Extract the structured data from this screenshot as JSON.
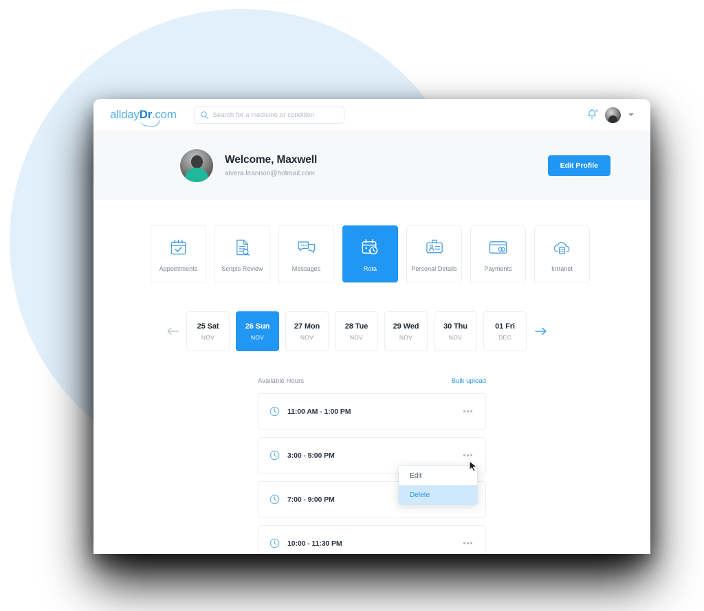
{
  "brand": {
    "logo_light_1": "allday",
    "logo_bold": "Dr",
    "logo_light_2": ".com",
    "accent_color": "#2196f3",
    "bg_circle_color": "#e1f0fb"
  },
  "topbar": {
    "search": {
      "placeholder": "Search for a medicine or condition",
      "value": "",
      "icon": "search-icon"
    },
    "notification_icon": "bell-icon",
    "avatar_icon": "user-avatar",
    "dropdown_icon": "chevron-down-icon"
  },
  "welcome": {
    "title": "Welcome, Maxwell",
    "email": "alvera.leannon@hotmail.com",
    "edit_button": "Edit Profile"
  },
  "nav_cards": [
    {
      "label": "Appointments",
      "icon": "calendar-check-icon",
      "active": false
    },
    {
      "label": "Scripts Review",
      "icon": "document-search-icon",
      "active": false
    },
    {
      "label": "Messages",
      "icon": "chat-bubbles-icon",
      "active": false
    },
    {
      "label": "Rota",
      "icon": "calendar-clock-icon",
      "active": true
    },
    {
      "label": "Personal Details",
      "icon": "id-badge-icon",
      "active": false
    },
    {
      "label": "Payments",
      "icon": "credit-card-icon",
      "active": false
    },
    {
      "label": "Intranet",
      "icon": "cloud-file-icon",
      "active": false
    }
  ],
  "date_strip": {
    "prev_icon": "arrow-left-icon",
    "next_icon": "arrow-right-icon",
    "days": [
      {
        "day": "25 Sat",
        "month": "NOV",
        "active": false
      },
      {
        "day": "26 Sun",
        "month": "NOV",
        "active": true
      },
      {
        "day": "27 Mon",
        "month": "NOV",
        "active": false
      },
      {
        "day": "28 Tue",
        "month": "NOV",
        "active": false
      },
      {
        "day": "29 Wed",
        "month": "NOV",
        "active": false
      },
      {
        "day": "30 Thu",
        "month": "NOV",
        "active": false
      },
      {
        "day": "01 Fri",
        "month": "DEC",
        "active": false
      }
    ]
  },
  "hours": {
    "title": "Available Hours",
    "bulk_upload": "Bulk upload",
    "slots": [
      {
        "time": "11:00 AM - 1:00 PM",
        "icon": "clock-icon",
        "menu_icon": "more-options-icon"
      },
      {
        "time": "3:00 - 5:00 PM",
        "icon": "clock-icon",
        "menu_icon": "more-options-icon"
      },
      {
        "time": "7:00 - 9:00 PM",
        "icon": "clock-icon",
        "menu_icon": "more-options-icon"
      },
      {
        "time": "10:00 - 11:30 PM",
        "icon": "clock-icon",
        "menu_icon": "more-options-icon"
      }
    ]
  },
  "context_menu": {
    "open": true,
    "items": [
      {
        "label": "Edit",
        "selected": false
      },
      {
        "label": "Delete",
        "selected": true
      }
    ]
  }
}
